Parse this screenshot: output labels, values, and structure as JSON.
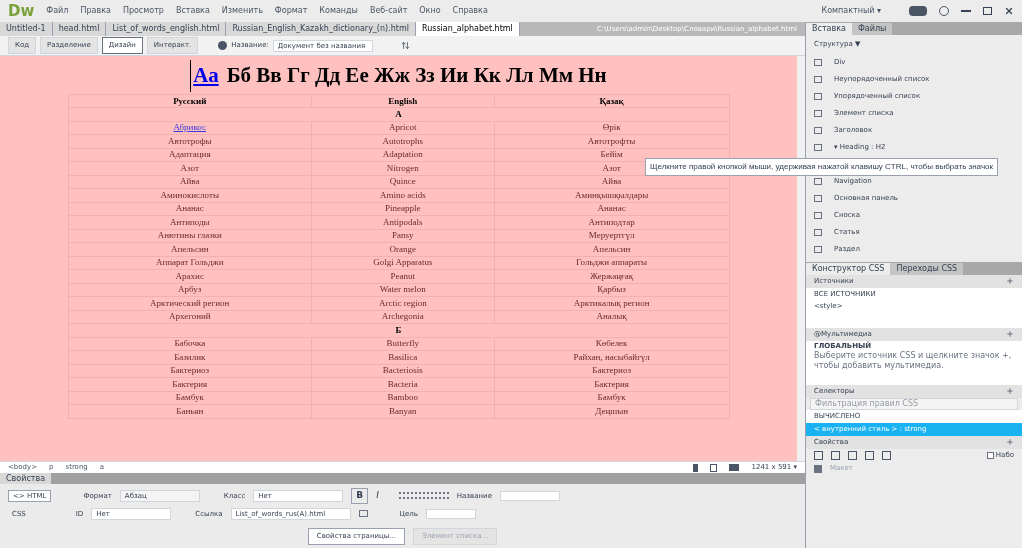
{
  "app": {
    "logo": "Dw",
    "menu": [
      "Файл",
      "Правка",
      "Просмотр",
      "Вставка",
      "Изменить",
      "Формат",
      "Команды",
      "Веб-сайт",
      "Окно",
      "Справка"
    ],
    "workspace": "Компактный ▾"
  },
  "doc_tabs": [
    {
      "label": "Untitled-1",
      "selected": false
    },
    {
      "label": "head.html",
      "selected": false
    },
    {
      "label": "List_of_words_english.html",
      "selected": false
    },
    {
      "label": "Russian_English_Kazakh_dictionary_(n).html",
      "selected": false
    },
    {
      "label": "Russian_alphabet.html",
      "selected": true
    }
  ],
  "file_path": "C:\\Users\\admin\\Desktop\\Словари\\Russian_alphabet.html",
  "view_buttons": [
    {
      "label": "Код",
      "selected": false
    },
    {
      "label": "Разделение",
      "selected": false
    },
    {
      "label": "Дизайн",
      "selected": true
    },
    {
      "label": "Интеракт.",
      "selected": false
    }
  ],
  "title_field": {
    "label": "Название:",
    "value": "Документ без названия"
  },
  "page": {
    "first_letter": "Аа",
    "heading": "Бб Вв Гг Дд Ее Жж Зз Ии Кк Лл Мм Нн",
    "columns": [
      "Русский",
      "English",
      "Қазақ"
    ],
    "rows": [
      {
        "kind": "letter",
        "letter": "А"
      },
      {
        "kind": "word",
        "link": true,
        "cells": [
          "Абрикос",
          "Apricot",
          "Өрік"
        ]
      },
      {
        "kind": "word",
        "link": false,
        "cells": [
          "Автотрофы",
          "Autotrophs",
          "Автотрофты"
        ]
      },
      {
        "kind": "word",
        "link": false,
        "cells": [
          "Адаптация",
          "Adaptation",
          "Бейім"
        ]
      },
      {
        "kind": "word",
        "link": false,
        "cells": [
          "Азот",
          "Nitrogen",
          "Азот"
        ]
      },
      {
        "kind": "word",
        "link": false,
        "cells": [
          "Айва",
          "Quince",
          "Айва"
        ]
      },
      {
        "kind": "word",
        "link": false,
        "cells": [
          "Аминокислоты",
          "Amino acids",
          "Аминқышқылдары"
        ]
      },
      {
        "kind": "word",
        "link": false,
        "cells": [
          "Ананас",
          "Pineapple",
          "Ананас"
        ]
      },
      {
        "kind": "word",
        "link": false,
        "cells": [
          "Антиподы",
          "Antipodals",
          "Антиподтар"
        ]
      },
      {
        "kind": "word",
        "link": false,
        "cells": [
          "Анютины глазки",
          "Pansy",
          "Меруертгүл"
        ]
      },
      {
        "kind": "word",
        "link": false,
        "cells": [
          "Апельсин",
          "Orange",
          "Апельсин"
        ]
      },
      {
        "kind": "word",
        "link": false,
        "cells": [
          "Аппарат Гольджи",
          "Golgi Apparatus",
          "Гольджи аппараты"
        ]
      },
      {
        "kind": "word",
        "link": false,
        "cells": [
          "Арахис",
          "Peanut",
          "Жержаңғақ"
        ]
      },
      {
        "kind": "word",
        "link": false,
        "cells": [
          "Арбуз",
          "Water melon",
          "Қарбыз"
        ]
      },
      {
        "kind": "word",
        "link": false,
        "cells": [
          "Арктический регион",
          "Arctic region",
          "Арктикалық регион"
        ]
      },
      {
        "kind": "word",
        "link": false,
        "cells": [
          "Архегоний",
          "Archegonia",
          "Аналық"
        ]
      },
      {
        "kind": "letter",
        "letter": "Б"
      },
      {
        "kind": "word",
        "link": false,
        "cells": [
          "Бабочка",
          "Butterfly",
          "Көбелек"
        ]
      },
      {
        "kind": "word",
        "link": false,
        "cells": [
          "Базилик",
          "Basilica",
          "Райхан, насыбайгүл"
        ]
      },
      {
        "kind": "word",
        "link": false,
        "cells": [
          "Бактериоз",
          "Bacteriosis",
          "Бактериоз"
        ]
      },
      {
        "kind": "word",
        "link": false,
        "cells": [
          "Бактерия",
          "Bacteria",
          "Бактерия"
        ]
      },
      {
        "kind": "word",
        "link": false,
        "cells": [
          "Бамбук",
          "Bamboo",
          "Бамбук"
        ]
      },
      {
        "kind": "word",
        "link": false,
        "cells": [
          "Баньян",
          "Banyan",
          "Деңшын"
        ]
      }
    ]
  },
  "tooltip": "Щелкните правой кнопкой мыши, удерживая нажатой клавишу CTRL, чтобы выбрать значок",
  "tag_bar": [
    "<body>",
    "p",
    "strong",
    "a"
  ],
  "window_size": "1241 x 591 ▾",
  "insert_panel": {
    "tabs": [
      {
        "label": "Вставка",
        "selected": true
      },
      {
        "label": "Файлы",
        "selected": false
      }
    ],
    "category": "Структура ▼",
    "items": [
      "Div",
      "Неупорядоченный список",
      "Упорядоченный список",
      "Элемент списка",
      "Заголовок",
      "▾ Heading : H2",
      "Navigation",
      "Основная панель",
      "Сноска",
      "Статья",
      "Раздел"
    ]
  },
  "css_panel": {
    "tabs": [
      {
        "label": "Конструктор CSS",
        "selected": true
      },
      {
        "label": "Переходы CSS",
        "selected": false
      }
    ],
    "sources_title": "Источники",
    "sources": [
      "ВСЕ ИСТОЧНИКИ",
      "<style>"
    ],
    "media_title": "@Мультимедиа",
    "media_global": "ГЛОБАЛЬНЫЙ",
    "media_hint": "Выберите источник CSS и щелкните значок +, чтобы добавить мультимедиа.",
    "selectors_title": "Селекторы",
    "filter_placeholder": "Фильтрация правил CSS",
    "selectors": [
      {
        "label": "ВЫЧИСЛЕНО",
        "selected": false
      },
      {
        "label": "< внутренний стиль > : strong",
        "selected": true
      }
    ],
    "properties_title": "Свойства",
    "show_set": {
      "label": "Набо",
      "checked": false
    },
    "layout": "Макет"
  },
  "properties": {
    "tab": "Свойства",
    "html": "<> HTML",
    "css": "CSS",
    "format_label": "Формат",
    "format": "Абзац",
    "id_label": "ID",
    "id": "Нет",
    "class_label": "Класс",
    "class": "Нет",
    "bold": "B",
    "italic": "I",
    "title_label": "Название",
    "link_label": "Ссылка",
    "link": "List_of_words_rus(A).html",
    "target_label": "Цель",
    "page_props": "Свойства страницы...",
    "list_item": {
      "label": "Элемент списка...",
      "disabled": true
    }
  }
}
